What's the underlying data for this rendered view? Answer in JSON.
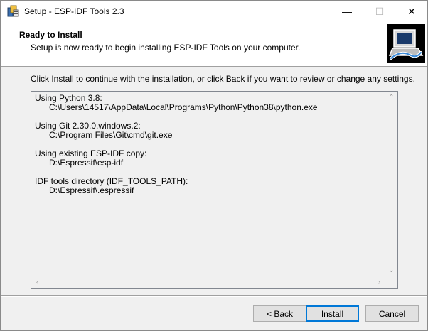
{
  "window": {
    "title": "Setup - ESP-IDF Tools 2.3",
    "minimize_glyph": "—",
    "maximize_glyph": "☐",
    "close_glyph": "✕"
  },
  "header": {
    "title": "Ready to Install",
    "subtitle": "Setup is now ready to begin installing ESP-IDF Tools on your computer."
  },
  "instruction": "Click Install to continue with the installation, or click Back if you want to review or change any settings.",
  "summary": {
    "lines": [
      "Using Python 3.8:",
      "      C:\\Users\\14517\\AppData\\Local\\Programs\\Python\\Python38\\python.exe",
      "",
      "Using Git 2.30.0.windows.2:",
      "      C:\\Program Files\\Git\\cmd\\git.exe",
      "",
      "Using existing ESP-IDF copy:",
      "      D:\\Espressif\\esp-idf",
      "",
      "IDF tools directory (IDF_TOOLS_PATH):",
      "      D:\\Espressif\\.espressif"
    ]
  },
  "buttons": {
    "back": "< Back",
    "install": "Install",
    "cancel": "Cancel"
  },
  "icons": {
    "app": "setup-installer-icon",
    "wizard": "computer-install-icon"
  },
  "colors": {
    "default_button_border": "#0078d7",
    "dialog_bg": "#f0f0f0"
  }
}
